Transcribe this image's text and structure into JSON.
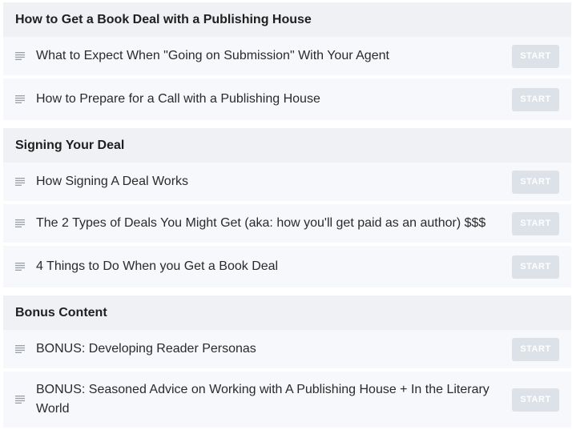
{
  "sections": [
    {
      "title": "How to Get a Book Deal with a Publishing House",
      "lessons": [
        {
          "title": "What to Expect When \"Going on Submission\" With Your Agent",
          "button": "START"
        },
        {
          "title": "How to Prepare for a Call with a Publishing House",
          "button": "START"
        }
      ]
    },
    {
      "title": "Signing Your Deal",
      "lessons": [
        {
          "title": "How Signing A Deal Works",
          "button": "START"
        },
        {
          "title": "The 2 Types of Deals You Might Get (aka: how you'll get paid as an author) $$$",
          "button": "START"
        },
        {
          "title": "4 Things to Do When you Get a Book Deal",
          "button": "START"
        }
      ]
    },
    {
      "title": "Bonus Content",
      "lessons": [
        {
          "title": "BONUS: Developing Reader Personas",
          "button": "START"
        },
        {
          "title": "BONUS: Seasoned Advice on Working with A Publishing House + In the Literary World",
          "button": "START"
        }
      ]
    }
  ],
  "icons": {
    "lesson": "text-lines-icon"
  },
  "colors": {
    "header_bg": "#f0f1f4",
    "row_bg": "#f7f8fb",
    "button_bg": "#dde2e8"
  }
}
